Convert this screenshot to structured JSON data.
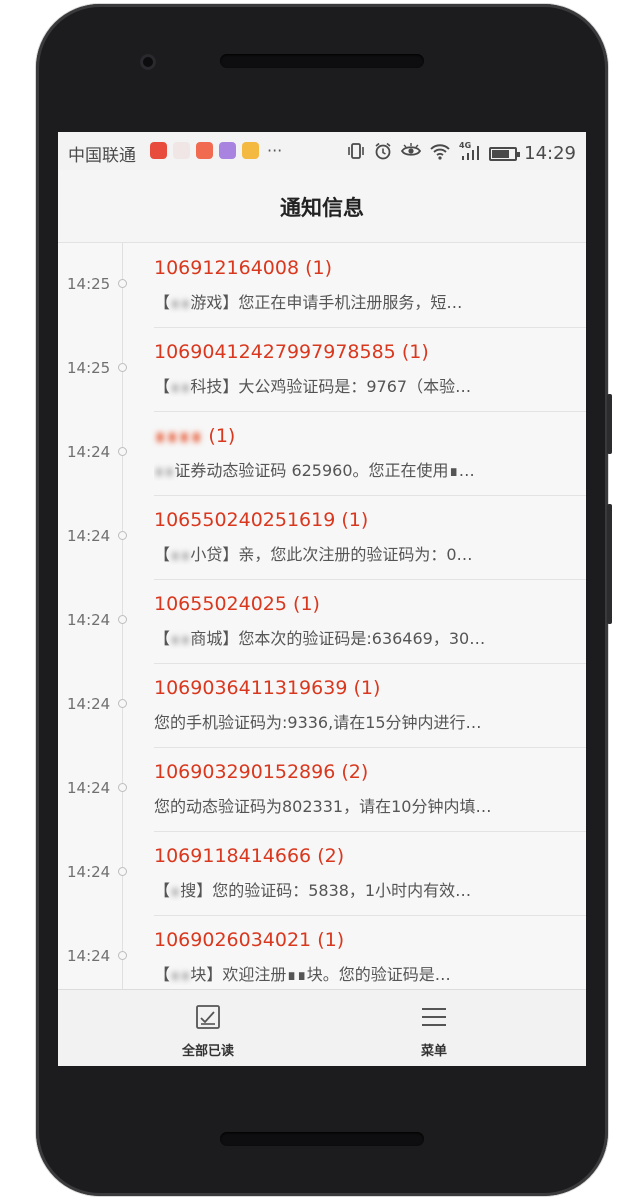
{
  "status_bar": {
    "carrier": "中国联通",
    "more": "···",
    "network": "4G",
    "time": "14:29",
    "battery_level": 0.75,
    "app_icon_colors": [
      "#e84c3d",
      "#f0e6e6",
      "#f06b4f",
      "#a983e0",
      "#f4b940"
    ]
  },
  "header": {
    "title": "通知信息"
  },
  "colors": {
    "accent": "#d9381e",
    "background": "#f7f7f7"
  },
  "messages": [
    {
      "time": "14:25",
      "sender": "106912164008",
      "count": "(1)",
      "preview_parts": [
        "【",
        "∎∎",
        "游戏】您正在申请手机注册服务，短…"
      ]
    },
    {
      "time": "14:25",
      "sender": "1069041242799797858​5",
      "count": "(1)",
      "preview_parts": [
        "【",
        "∎∎",
        "科技】大公鸡验证码是：9767（本验…"
      ]
    },
    {
      "time": "14:24",
      "sender": "∎∎∎∎",
      "count": "(1)",
      "preview_parts": [
        "",
        "∎∎",
        "证券动态验证码 625960。您正在使用∎…"
      ]
    },
    {
      "time": "14:24",
      "sender": "106550240251619",
      "count": "(1)",
      "preview_parts": [
        "【",
        "∎∎",
        "小贷】亲，您此次注册的验证码为：0…"
      ]
    },
    {
      "time": "14:24",
      "sender": "10655024025",
      "count": "(1)",
      "preview_parts": [
        "【",
        "∎∎",
        "商城】您本次的验证码是:636469，30…"
      ]
    },
    {
      "time": "14:24",
      "sender": "1069036411319639",
      "count": "(1)",
      "preview_parts": [
        "",
        "",
        "您的手机验证码为:9336,请在15分钟内进行…"
      ]
    },
    {
      "time": "14:24",
      "sender": "106903290152896",
      "count": "(2)",
      "preview_parts": [
        "",
        "",
        "您的动态验证码为802331，请在10分钟内填…"
      ]
    },
    {
      "time": "14:24",
      "sender": "1069118414666",
      "count": "(2)",
      "preview_parts": [
        "【",
        "∎",
        "搜】您的验证码：5838，1小时内有效…"
      ]
    },
    {
      "time": "14:24",
      "sender": "1069026034021",
      "count": "(1)",
      "preview_parts": [
        "【",
        "∎∎",
        "块】欢迎注册∎∎块。您的验证码是…"
      ]
    }
  ],
  "bottom_bar": {
    "mark_all_read": "全部已读",
    "menu": "菜单"
  }
}
